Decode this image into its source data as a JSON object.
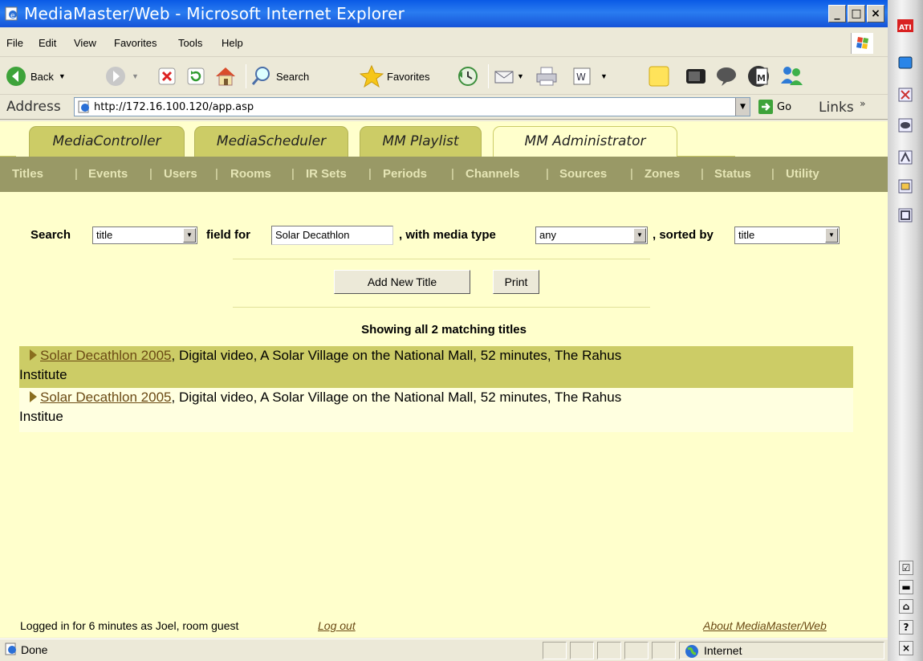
{
  "window": {
    "title": "MediaMaster/Web - Microsoft Internet Explorer",
    "buttons": [
      "_",
      "□",
      "×"
    ]
  },
  "menu": [
    "File",
    "Edit",
    "View",
    "Favorites",
    "Tools",
    "Help"
  ],
  "toolbar": {
    "back": "Back",
    "search": "Search",
    "favorites": "Favorites"
  },
  "address": {
    "label": "Address",
    "url": "http://172.16.100.120/app.asp",
    "go": "Go",
    "links": "Links",
    "links_chevron": "»"
  },
  "tabs": [
    "MediaController",
    "MediaScheduler",
    "MM Playlist",
    "MM Administrator"
  ],
  "nav": [
    "Titles",
    "Events",
    "Users",
    "Rooms",
    "IR Sets",
    "Periods",
    "Channels",
    "Sources",
    "Zones",
    "Status",
    "Utility"
  ],
  "nav_sep": "|",
  "search": {
    "label": "Search",
    "field_value": "title",
    "field_for_label": "field for",
    "query": "Solar Decathlon",
    "media_type_label": ", with media type",
    "media_type_value": "any",
    "sorted_by_label": ", sorted by",
    "sorted_by_value": "title"
  },
  "buttons": {
    "add_new_title": "Add New Title",
    "print": "Print"
  },
  "results": {
    "heading": "Showing all 2 matching titles",
    "items": [
      {
        "title": "Solar Decathlon 2005",
        "details": ", Digital video, A Solar Village on the National Mall, 52 minutes, The Rahus",
        "details_cont": "Institute"
      },
      {
        "title": "Solar Decathlon 2005",
        "details": ", Digital video, A Solar Village on the National Mall, 52 minutes, The Rahus",
        "details_cont": "Institue"
      }
    ]
  },
  "footer": {
    "login_text": "Logged in for 6 minutes as Joel, room guest",
    "logout": "Log out",
    "about": "About MediaMaster/Web"
  },
  "status": {
    "left": "Done",
    "zone": "Internet"
  },
  "colors": {
    "page_bg": "#ffffcc",
    "tab_bg": "#cccc66",
    "nav_bg": "#999966",
    "nav_text": "#e5e5b5",
    "row_highlight": "#cccc66",
    "link": "#6b4a14"
  }
}
